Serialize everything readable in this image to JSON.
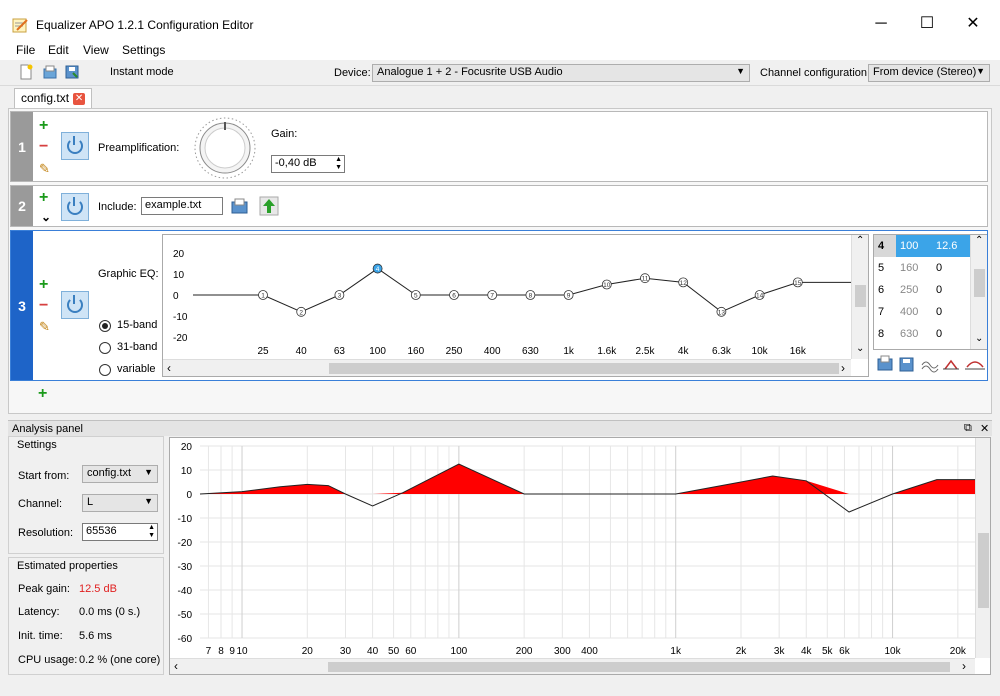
{
  "window": {
    "title": "Equalizer APO 1.2.1 Configuration Editor",
    "minimize": "─",
    "maximize": "☐",
    "close": "✕"
  },
  "menu": [
    "File",
    "Edit",
    "View",
    "Settings"
  ],
  "toolbar": {
    "instant_mode_label": "Instant mode",
    "instant_mode_checked": true,
    "device_label": "Device:",
    "device_value": "Analogue 1 + 2 - Focusrite USB Audio",
    "channel_config_label": "Channel configuration:",
    "channel_config_value": "From device (Stereo)"
  },
  "tab": {
    "label": "config.txt",
    "close": "✕"
  },
  "filters": [
    {
      "number": "1",
      "type": "Preamplification:",
      "gain_label": "Gain:",
      "gain_value": "-0,40 dB"
    },
    {
      "number": "2",
      "type": "Include:",
      "file": "example.txt"
    },
    {
      "number": "3",
      "type": "Graphic EQ:"
    }
  ],
  "geq": {
    "bands": [
      {
        "label": "15-band",
        "selected": true
      },
      {
        "label": "31-band",
        "selected": false
      },
      {
        "label": "variable",
        "selected": false
      }
    ],
    "y_ticks": [
      "20",
      "10",
      "0",
      "-10",
      "-20"
    ],
    "x_ticks": [
      "25",
      "40",
      "63",
      "100",
      "160",
      "250",
      "400",
      "630",
      "1k",
      "1.6k",
      "2.5k",
      "4k",
      "6.3k",
      "10k",
      "16k"
    ],
    "node_gains": [
      0,
      -8,
      0,
      12.6,
      0,
      0,
      0,
      0,
      0,
      5,
      8,
      6,
      -8,
      0,
      6
    ],
    "table": [
      {
        "index": "4",
        "freq": "100",
        "gain": "12.6",
        "selected": true
      },
      {
        "index": "5",
        "freq": "160",
        "gain": "0"
      },
      {
        "index": "6",
        "freq": "250",
        "gain": "0"
      },
      {
        "index": "7",
        "freq": "400",
        "gain": "0"
      },
      {
        "index": "8",
        "freq": "630",
        "gain": "0"
      }
    ]
  },
  "analysis": {
    "panel_title": "Analysis panel",
    "settings_title": "Settings",
    "start_from_label": "Start from:",
    "start_from_value": "config.txt",
    "channel_label": "Channel:",
    "channel_value": "L",
    "resolution_label": "Resolution:",
    "resolution_value": "65536",
    "estimated_title": "Estimated properties",
    "peak_gain_label": "Peak gain:",
    "peak_gain_value": "12.5 dB",
    "latency_label": "Latency:",
    "latency_value": "0.0 ms (0 s.)",
    "init_time_label": "Init. time:",
    "init_time_value": "5.6 ms",
    "cpu_label": "CPU usage:",
    "cpu_value": "0.2 % (one core)"
  },
  "chart_data": {
    "type": "area",
    "y_ticks": [
      "20",
      "10",
      "0",
      "-10",
      "-20",
      "-30",
      "-40",
      "-50",
      "-60"
    ],
    "ylim": [
      -60,
      20
    ],
    "x_ticks": [
      "7",
      "8",
      "9",
      "10",
      "20",
      "30",
      "40",
      "50",
      "60",
      "100",
      "200",
      "300",
      "400",
      "1k",
      "2k",
      "3k",
      "4k",
      "5k",
      "6k",
      "10k",
      "20k"
    ],
    "x_tick_values": [
      7,
      8,
      9,
      10,
      20,
      30,
      40,
      50,
      60,
      100,
      200,
      300,
      400,
      1000,
      2000,
      3000,
      4000,
      5000,
      6000,
      10000,
      20000
    ],
    "response": {
      "x": [
        6,
        10,
        15,
        20,
        25,
        30,
        40,
        55,
        100,
        200,
        300,
        500,
        1000,
        2000,
        2800,
        4000,
        6300,
        10000,
        16000,
        24000
      ],
      "y": [
        0,
        1,
        3,
        4,
        3.5,
        0,
        -5,
        0.5,
        12.5,
        0,
        0,
        0,
        0,
        5,
        7.5,
        5.5,
        -7.5,
        0,
        6,
        6
      ]
    },
    "fill_color": "#ff0000"
  },
  "icons": {
    "add": "+",
    "remove": "−",
    "edit": "✎",
    "collapse": "⌄",
    "dropdown": "▼",
    "spin_up": "▲",
    "spin_down": "▼",
    "float": "⧉",
    "panel_close": "✕",
    "scroll_up": "⌃",
    "scroll_down": "⌄",
    "scroll_left": "‹",
    "scroll_right": "›"
  }
}
